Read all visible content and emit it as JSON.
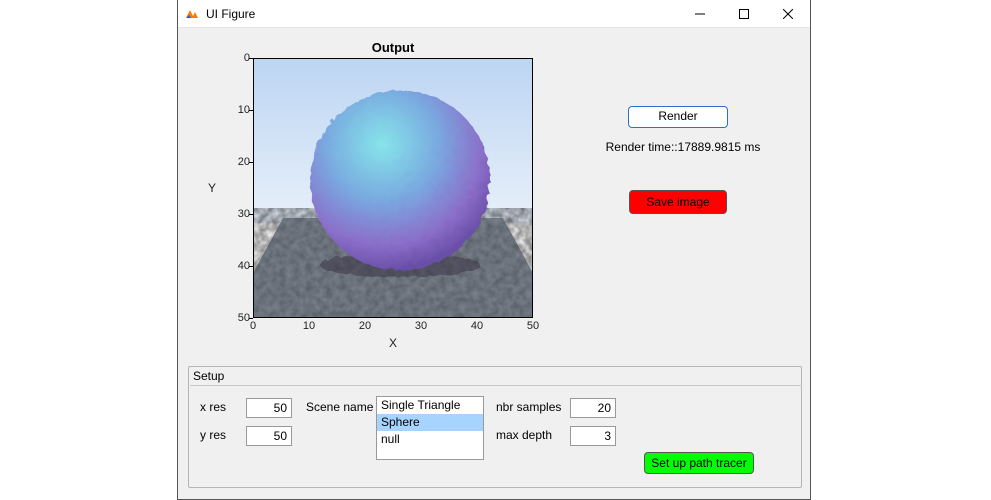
{
  "window": {
    "title": "UI Figure"
  },
  "axes": {
    "title": "Output",
    "xlabel": "X",
    "ylabel": "Y",
    "xticks": [
      "0",
      "10",
      "20",
      "30",
      "40",
      "50"
    ],
    "yticks": [
      "0",
      "10",
      "20",
      "30",
      "40",
      "50"
    ]
  },
  "controls": {
    "render_label": "Render",
    "render_time_text": "Render time::17889.9815 ms",
    "save_label": "Save image"
  },
  "setup": {
    "panel_title": "Setup",
    "xres_label": "x res",
    "xres_value": "50",
    "yres_label": "y res",
    "yres_value": "50",
    "scene_label": "Scene name",
    "scene_items": [
      "Single Triangle",
      "Sphere",
      "null"
    ],
    "scene_selected_index": 1,
    "nbr_samples_label": "nbr samples",
    "nbr_samples_value": "20",
    "max_depth_label": "max depth",
    "max_depth_value": "3",
    "setup_btn_label": "Set up path tracer"
  }
}
